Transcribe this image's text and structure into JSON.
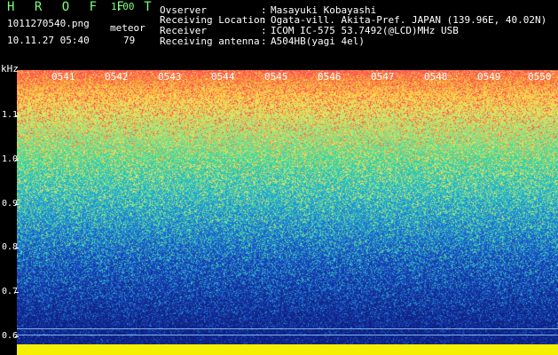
{
  "app": {
    "title": "H R O F F T",
    "version": "1.00"
  },
  "file": {
    "name": "1011270540.png",
    "datetime": "10.11.27 05:40"
  },
  "meteor": {
    "label": "meteor",
    "count": "79"
  },
  "info": [
    {
      "label": "Ovserver",
      "value": "Masayuki Kobayashi"
    },
    {
      "label": "Receiving Location",
      "value": "Ogata-vill. Akita-Pref. JAPAN (139.96E, 40.02N)"
    },
    {
      "label": "Receiver",
      "value": "ICOM IC-575 53.7492(@LCD)MHz USB"
    },
    {
      "label": "Receiving antenna",
      "value": "A504HB(yagi 4el)"
    }
  ],
  "axis": {
    "unit": "kHz",
    "y_ticks": [
      "1.1",
      "1.0",
      "0.9",
      "0.8",
      "0.7",
      "0.6"
    ],
    "x_ticks": [
      "0541",
      "0542",
      "0543",
      "0544",
      "0545",
      "0546",
      "0547",
      "0548",
      "0549",
      "0550"
    ]
  },
  "colors": {
    "title_green": "#7cff7c",
    "band_yellow": "#f4f000"
  }
}
